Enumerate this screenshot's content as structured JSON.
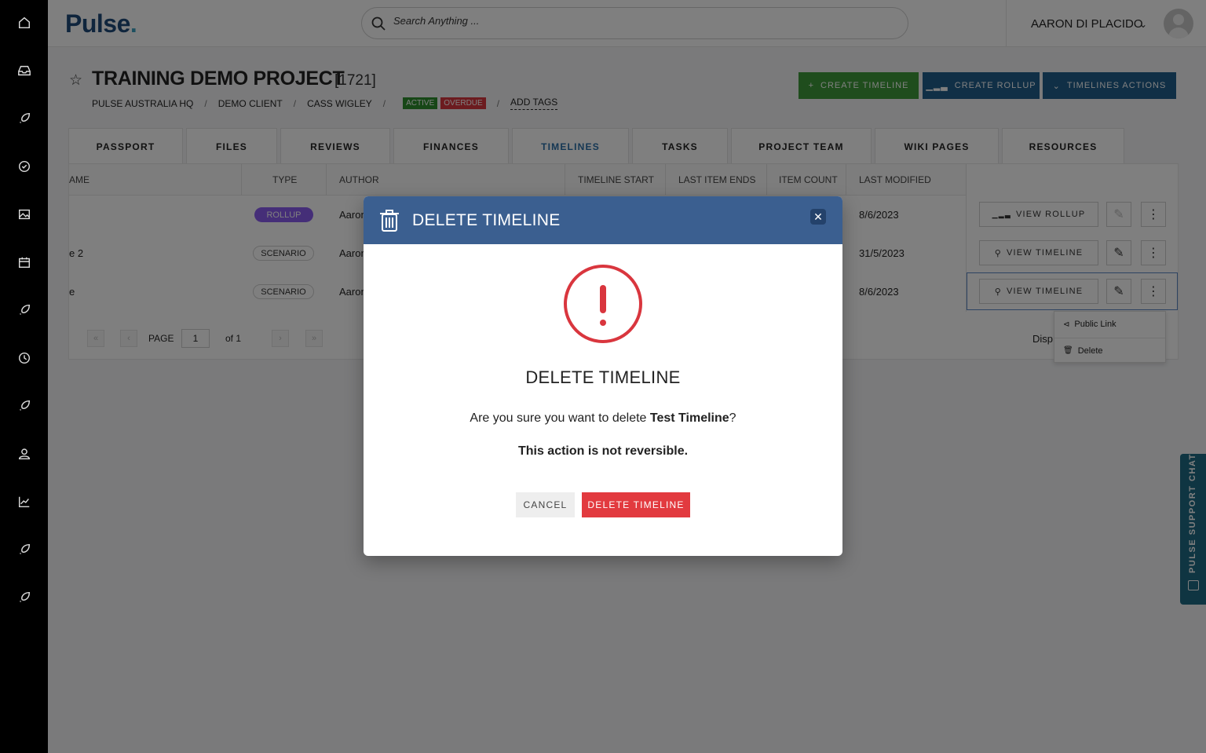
{
  "header": {
    "logo": "Pulse",
    "logo_dot": ".",
    "search_placeholder": "Search Anything ...",
    "user_name": "AARON DI PLACIDO"
  },
  "project": {
    "title": "TRAINING DEMO PROJECT",
    "id": "[1721]",
    "breadcrumbs": [
      "PULSE AUSTRALIA HQ",
      "DEMO CLIENT",
      "CASS WIGLEY"
    ],
    "tags": {
      "active": "ACTIVE",
      "overdue": "OVERDUE"
    },
    "add_tags": "ADD TAGS"
  },
  "actions": {
    "create_timeline": "CREATE TIMELINE",
    "create_rollup": "CREATE ROLLUP",
    "timelines_actions": "TIMELINES ACTIONS"
  },
  "tabs": [
    "PASSPORT",
    "FILES",
    "REVIEWS",
    "FINANCES",
    "TIMELINES",
    "TASKS",
    "PROJECT TEAM",
    "WIKI PAGES",
    "RESOURCES"
  ],
  "active_tab": "TIMELINES",
  "table": {
    "columns": [
      "AME",
      "TYPE",
      "AUTHOR",
      "TIMELINE START",
      "LAST ITEM ENDS",
      "ITEM COUNT",
      "LAST MODIFIED"
    ],
    "rows": [
      {
        "name": "",
        "type": "ROLLUP",
        "author": "Aaron",
        "modified": "8/6/2023",
        "action": "VIEW ROLLUP"
      },
      {
        "name": "e 2",
        "type": "SCENARIO",
        "author": "Aaron",
        "modified": "31/5/2023",
        "action": "VIEW TIMELINE"
      },
      {
        "name": "e",
        "type": "SCENARIO",
        "author": "Aaron",
        "modified": "8/6/2023",
        "action": "VIEW TIMELINE"
      }
    ],
    "pager": {
      "page_label": "PAGE",
      "page_value": "1",
      "of_label": "of 1",
      "display_text": "Disp"
    }
  },
  "dropdown": {
    "public_link": "Public Link",
    "delete": "Delete"
  },
  "support_chat": "PULSE SUPPORT CHAT",
  "modal": {
    "header_title": "DELETE TIMELINE",
    "heading": "DELETE TIMELINE",
    "question_prefix": "Are you sure you want to delete ",
    "question_name": "Test Timeline",
    "question_suffix": "?",
    "warning": "This action is not reversible.",
    "cancel": "CANCEL",
    "confirm": "DELETE TIMELINE"
  },
  "colors": {
    "brand": "#1f4a7a",
    "green": "#3f9b3a",
    "blue": "#205e8c",
    "danger": "#e23a3f",
    "modal_header": "#3b5f90"
  }
}
